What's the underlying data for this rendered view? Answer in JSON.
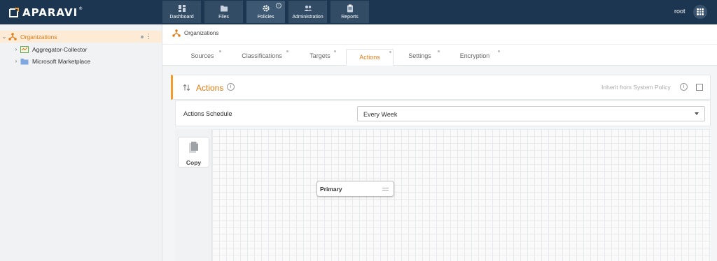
{
  "app": {
    "brand": "APARAVI",
    "trademark": "®"
  },
  "nav": {
    "dashboard": "Dashboard",
    "files": "Files",
    "policies": "Policies",
    "administration": "Administration",
    "reports": "Reports",
    "active": "Policies",
    "policies_info_icon": "info-icon"
  },
  "user": {
    "name": "root",
    "apps_icon": "grid-icon"
  },
  "sidebar": {
    "items": [
      {
        "label": "Organizations",
        "icon": "hierarchy-icon",
        "expanded": true,
        "selected": true
      },
      {
        "label": "Aggregator-Collector",
        "icon": "aggregator-icon",
        "expanded": false
      },
      {
        "label": "Microsoft Marketplace",
        "icon": "folder-icon",
        "expanded": false
      }
    ]
  },
  "breadcrumb": {
    "label": "Organizations",
    "icon": "hierarchy-icon"
  },
  "tabs": [
    {
      "label": "Sources"
    },
    {
      "label": "Classifications"
    },
    {
      "label": "Targets"
    },
    {
      "label": "Actions",
      "active": true
    },
    {
      "label": "Settings"
    },
    {
      "label": "Encryption"
    }
  ],
  "panel": {
    "title": "Actions",
    "inherit_label": "Inherit from System Policy",
    "inherit_checked": false
  },
  "schedule": {
    "label": "Actions Schedule",
    "value": "Every Week"
  },
  "palette": {
    "copy_label": "Copy"
  },
  "canvas": {
    "node_label": "Primary"
  },
  "colors": {
    "accent": "#e07a14",
    "topbar": "#1c3550",
    "selected_bg": "#fdebd6"
  }
}
